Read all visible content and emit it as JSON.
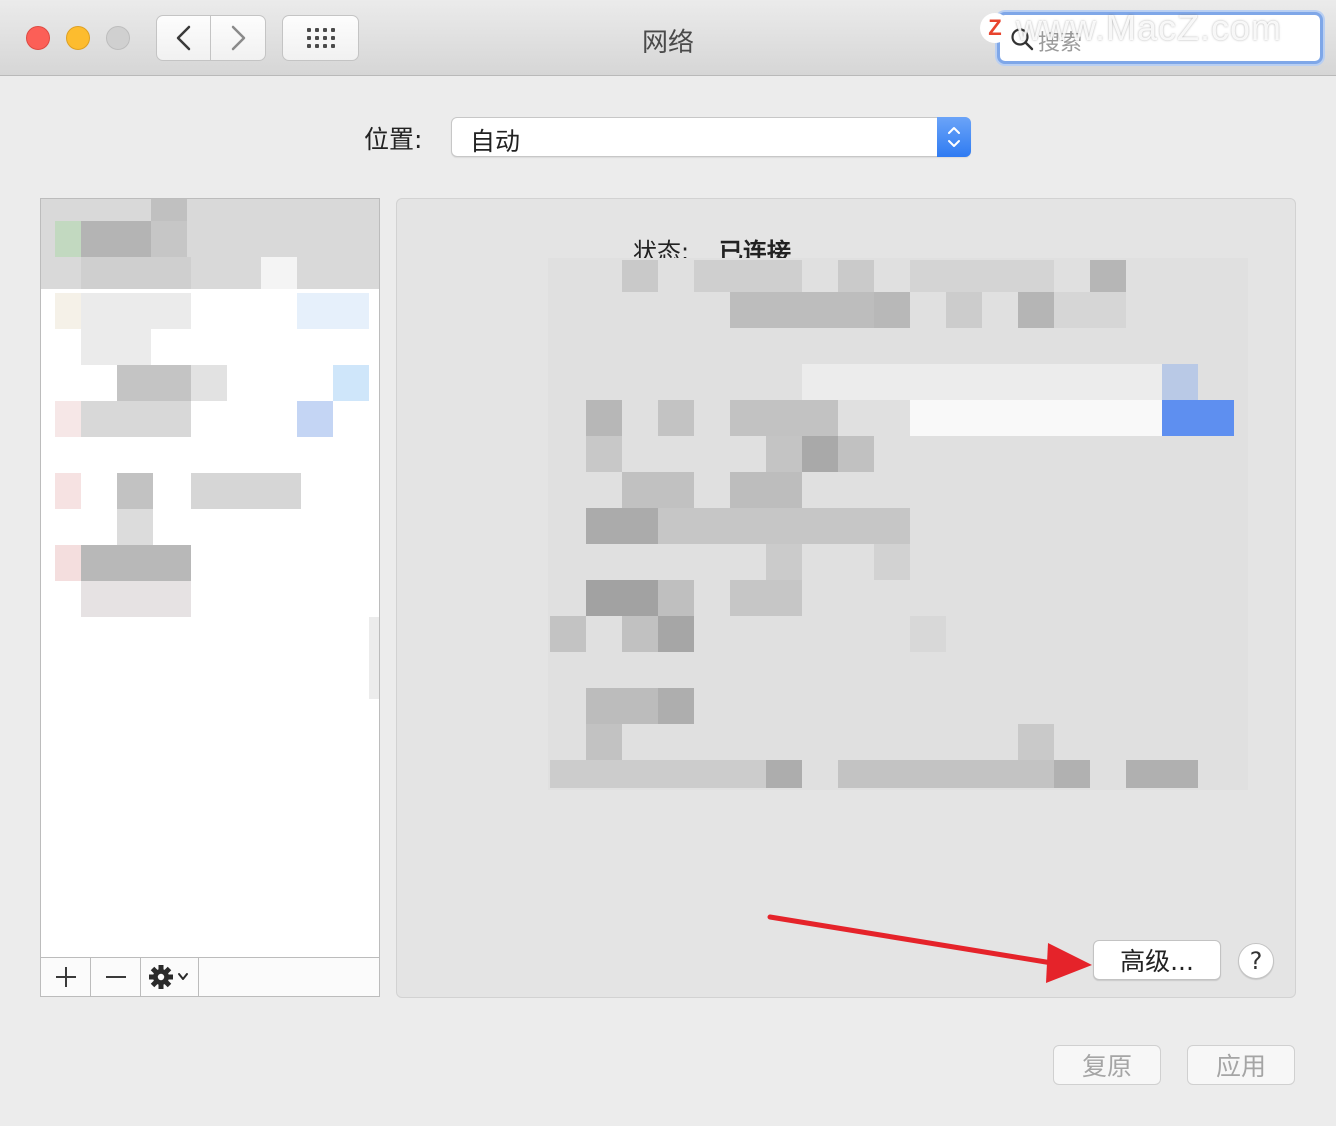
{
  "window": {
    "title": "网络",
    "search_placeholder": "搜索",
    "watermark_logo": "Z",
    "watermark_text": "www.MacZ.com"
  },
  "location": {
    "label": "位置:",
    "value": "自动"
  },
  "status": {
    "label": "状态:",
    "value": "已连接"
  },
  "buttons": {
    "advanced": "高级...",
    "help": "?",
    "revert": "复原",
    "apply": "应用"
  },
  "colors": {
    "accent": "#2f7bf2",
    "annotation_arrow": "#e5232a",
    "close": "#fc5f57",
    "minimize": "#fdbc2e"
  },
  "icons": {
    "back": "chevron-left-icon",
    "forward": "chevron-right-icon",
    "show_all": "grid-icon",
    "search": "search-icon",
    "add": "plus-icon",
    "remove": "minus-icon",
    "action": "gear-icon",
    "popup": "updown-chevron-icon"
  }
}
